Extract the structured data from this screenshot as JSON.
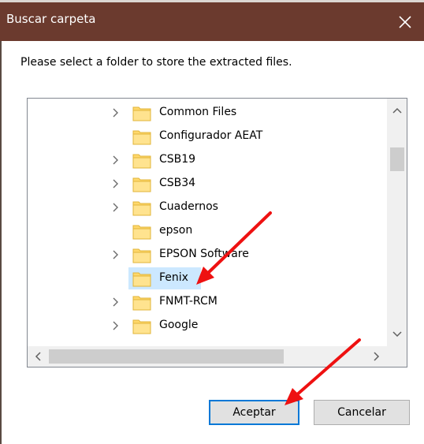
{
  "window": {
    "title": "Buscar carpeta",
    "close_icon": "close-icon",
    "title_bar_color": "#6b3a2e"
  },
  "instruction": "Please select a folder to store the extracted files.",
  "tree": {
    "items": [
      {
        "label": "Common Files",
        "has_children": true,
        "selected": false
      },
      {
        "label": "Configurador AEAT",
        "has_children": false,
        "selected": false
      },
      {
        "label": "CSB19",
        "has_children": true,
        "selected": false
      },
      {
        "label": "CSB34",
        "has_children": true,
        "selected": false
      },
      {
        "label": "Cuadernos",
        "has_children": true,
        "selected": false
      },
      {
        "label": "epson",
        "has_children": false,
        "selected": false
      },
      {
        "label": "EPSON Software",
        "has_children": true,
        "selected": false
      },
      {
        "label": "Fenix",
        "has_children": false,
        "selected": true
      },
      {
        "label": "FNMT-RCM",
        "has_children": true,
        "selected": false
      },
      {
        "label": "Google",
        "has_children": true,
        "selected": false
      }
    ],
    "selection_color": "#cce8ff",
    "folder_color": "#ffd86b"
  },
  "buttons": {
    "accept": "Aceptar",
    "cancel": "Cancelar"
  },
  "annotations": {
    "arrow_color": "#ee1111",
    "arrows": [
      "points-to-fenix",
      "points-to-aceptar"
    ]
  }
}
